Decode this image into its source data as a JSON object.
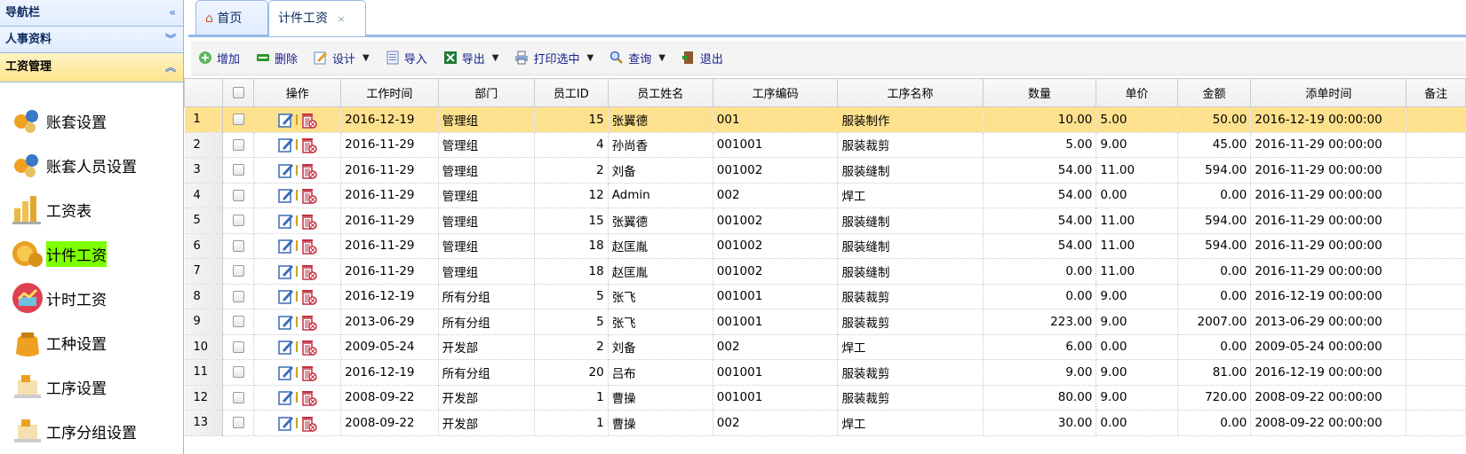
{
  "sidebar": {
    "header_nav": "导航栏",
    "header_personnel": "人事资料",
    "header_wage": "工资管理",
    "items": [
      {
        "label": "账套设置",
        "icon": "account-set-icon"
      },
      {
        "label": "账套人员设置",
        "icon": "account-people-icon"
      },
      {
        "label": "工资表",
        "icon": "wage-table-icon"
      },
      {
        "label": "计件工资",
        "icon": "coins-icon"
      },
      {
        "label": "计时工资",
        "icon": "timer-chart-icon"
      },
      {
        "label": "工种设置",
        "icon": "money-bag-icon"
      },
      {
        "label": "工序设置",
        "icon": "process-icon"
      },
      {
        "label": "工序分组设置",
        "icon": "process-group-icon"
      }
    ]
  },
  "tabs": {
    "home": "首页",
    "piecework": "计件工资",
    "close": "×"
  },
  "toolbar": {
    "add": "增加",
    "delete": "删除",
    "design": "设计",
    "import": "导入",
    "export": "导出",
    "print": "打印选中",
    "query": "查询",
    "exit": "退出"
  },
  "columns": [
    "操作",
    "工作时间",
    "部门",
    "员工ID",
    "员工姓名",
    "工序编码",
    "工序名称",
    "数量",
    "单价",
    "金额",
    "添单时间",
    "备注"
  ],
  "rows": [
    {
      "n": "1",
      "date": "2016-12-19",
      "dept": "管理组",
      "id": "15",
      "name": "张翼德",
      "code": "001",
      "proc": "服装制作",
      "qty": "10.00",
      "price": "5.00",
      "amt": "50.00",
      "added": "2016-12-19 00:00:00",
      "note": ""
    },
    {
      "n": "2",
      "date": "2016-11-29",
      "dept": "管理组",
      "id": "4",
      "name": "孙尚香",
      "code": "001001",
      "proc": "服装裁剪",
      "qty": "5.00",
      "price": "9.00",
      "amt": "45.00",
      "added": "2016-11-29 00:00:00",
      "note": ""
    },
    {
      "n": "3",
      "date": "2016-11-29",
      "dept": "管理组",
      "id": "2",
      "name": "刘备",
      "code": "001002",
      "proc": "服装缝制",
      "qty": "54.00",
      "price": "11.00",
      "amt": "594.00",
      "added": "2016-11-29 00:00:00",
      "note": ""
    },
    {
      "n": "4",
      "date": "2016-11-29",
      "dept": "管理组",
      "id": "12",
      "name": "Admin",
      "code": "002",
      "proc": "焊工",
      "qty": "54.00",
      "price": "0.00",
      "amt": "0.00",
      "added": "2016-11-29 00:00:00",
      "note": ""
    },
    {
      "n": "5",
      "date": "2016-11-29",
      "dept": "管理组",
      "id": "15",
      "name": "张翼德",
      "code": "001002",
      "proc": "服装缝制",
      "qty": "54.00",
      "price": "11.00",
      "amt": "594.00",
      "added": "2016-11-29 00:00:00",
      "note": ""
    },
    {
      "n": "6",
      "date": "2016-11-29",
      "dept": "管理组",
      "id": "18",
      "name": "赵匡胤",
      "code": "001002",
      "proc": "服装缝制",
      "qty": "54.00",
      "price": "11.00",
      "amt": "594.00",
      "added": "2016-11-29 00:00:00",
      "note": ""
    },
    {
      "n": "7",
      "date": "2016-11-29",
      "dept": "管理组",
      "id": "18",
      "name": "赵匡胤",
      "code": "001002",
      "proc": "服装缝制",
      "qty": "0.00",
      "price": "11.00",
      "amt": "0.00",
      "added": "2016-11-29 00:00:00",
      "note": ""
    },
    {
      "n": "8",
      "date": "2016-12-19",
      "dept": "所有分组",
      "id": "5",
      "name": "张飞",
      "code": "001001",
      "proc": "服装裁剪",
      "qty": "0.00",
      "price": "9.00",
      "amt": "0.00",
      "added": "2016-12-19 00:00:00",
      "note": ""
    },
    {
      "n": "9",
      "date": "2013-06-29",
      "dept": "所有分组",
      "id": "5",
      "name": "张飞",
      "code": "001001",
      "proc": "服装裁剪",
      "qty": "223.00",
      "price": "9.00",
      "amt": "2007.00",
      "added": "2013-06-29 00:00:00",
      "note": ""
    },
    {
      "n": "10",
      "date": "2009-05-24",
      "dept": "开发部",
      "id": "2",
      "name": "刘备",
      "code": "002",
      "proc": "焊工",
      "qty": "6.00",
      "price": "0.00",
      "amt": "0.00",
      "added": "2009-05-24 00:00:00",
      "note": ""
    },
    {
      "n": "11",
      "date": "2016-12-19",
      "dept": "所有分组",
      "id": "20",
      "name": "吕布",
      "code": "001001",
      "proc": "服装裁剪",
      "qty": "9.00",
      "price": "9.00",
      "amt": "81.00",
      "added": "2016-12-19 00:00:00",
      "note": ""
    },
    {
      "n": "12",
      "date": "2008-09-22",
      "dept": "开发部",
      "id": "1",
      "name": "曹操",
      "code": "001001",
      "proc": "服装裁剪",
      "qty": "80.00",
      "price": "9.00",
      "amt": "720.00",
      "added": "2008-09-22 00:00:00",
      "note": ""
    },
    {
      "n": "13",
      "date": "2008-09-22",
      "dept": "开发部",
      "id": "1",
      "name": "曹操",
      "code": "002",
      "proc": "焊工",
      "qty": "30.00",
      "price": "0.00",
      "amt": "0.00",
      "added": "2008-09-22 00:00:00",
      "note": ""
    }
  ],
  "colors": {
    "selected_row": "#fee18e",
    "accent": "#95b8e7",
    "selected_nav": "#7cff00"
  }
}
